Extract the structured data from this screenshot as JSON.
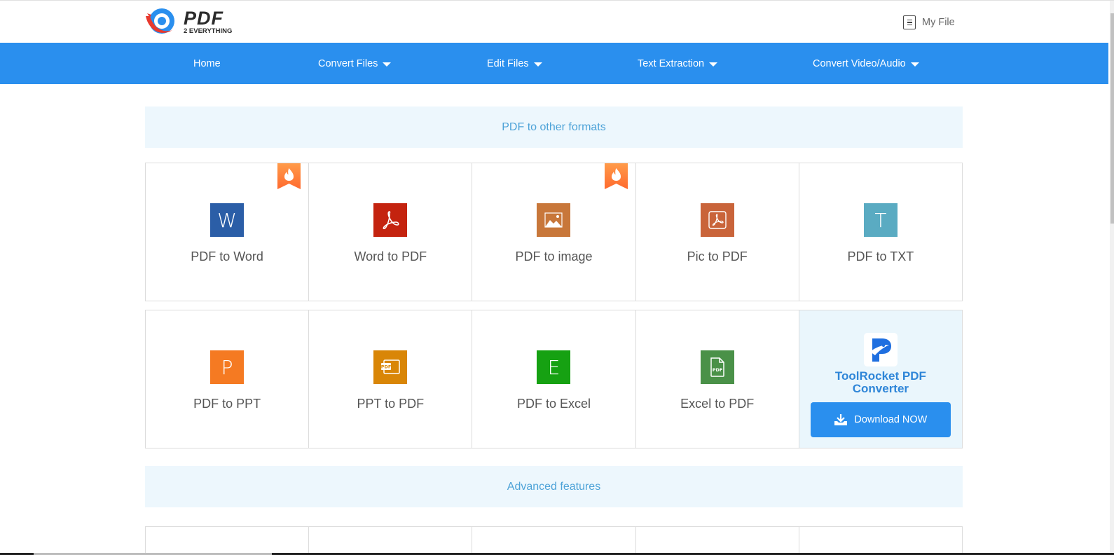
{
  "header": {
    "logo_main": "PDF",
    "logo_sub": "2 EVERYTHING",
    "my_file_label": "My File",
    "my_file_icon": "document-list-icon"
  },
  "nav": {
    "items": [
      {
        "label": "Home",
        "has_dropdown": false
      },
      {
        "label": "Convert Files",
        "has_dropdown": true
      },
      {
        "label": "Edit Files",
        "has_dropdown": true
      },
      {
        "label": "Text Extraction",
        "has_dropdown": true
      },
      {
        "label": "Convert Video/Audio",
        "has_dropdown": true
      }
    ],
    "color": "#2a8fee"
  },
  "sections": {
    "pdf_to_other": {
      "title": "PDF to other formats",
      "tools": [
        {
          "label": "PDF to Word",
          "icon": "word-icon",
          "glyph": "W",
          "color": "#2b5ea7",
          "hot": true
        },
        {
          "label": "Word to PDF",
          "icon": "acrobat-icon",
          "glyph": "",
          "color": "#c4230f",
          "hot": false
        },
        {
          "label": "PDF to image",
          "icon": "image-icon",
          "glyph": "",
          "color": "#c8773a",
          "hot": true
        },
        {
          "label": "Pic to PDF",
          "icon": "acrobat-box-icon",
          "glyph": "",
          "color": "#c9643a",
          "hot": false
        },
        {
          "label": "PDF to TXT",
          "icon": "text-icon",
          "glyph": "T",
          "color": "#5aabc2",
          "hot": false
        },
        {
          "label": "PDF to PPT",
          "icon": "powerpoint-icon",
          "glyph": "P",
          "color": "#f57a22",
          "hot": false
        },
        {
          "label": "PPT to PDF",
          "icon": "ppt-pdf-icon",
          "glyph": "",
          "color": "#d98607",
          "hot": false
        },
        {
          "label": "PDF to Excel",
          "icon": "excel-icon",
          "glyph": "E",
          "color": "#16a112",
          "hot": false
        },
        {
          "label": "Excel to PDF",
          "icon": "pdf-file-icon",
          "glyph": "",
          "color": "#4a9148",
          "hot": false
        }
      ],
      "promo": {
        "title": "ToolRocket PDF Converter",
        "button_label": "Download NOW",
        "accent": "#2f86d8"
      }
    },
    "advanced": {
      "title": "Advanced features"
    }
  },
  "colors": {
    "section_bg": "#edf7fd",
    "section_text": "#4ea3d8",
    "hot_badge": "#ff7a3a"
  }
}
